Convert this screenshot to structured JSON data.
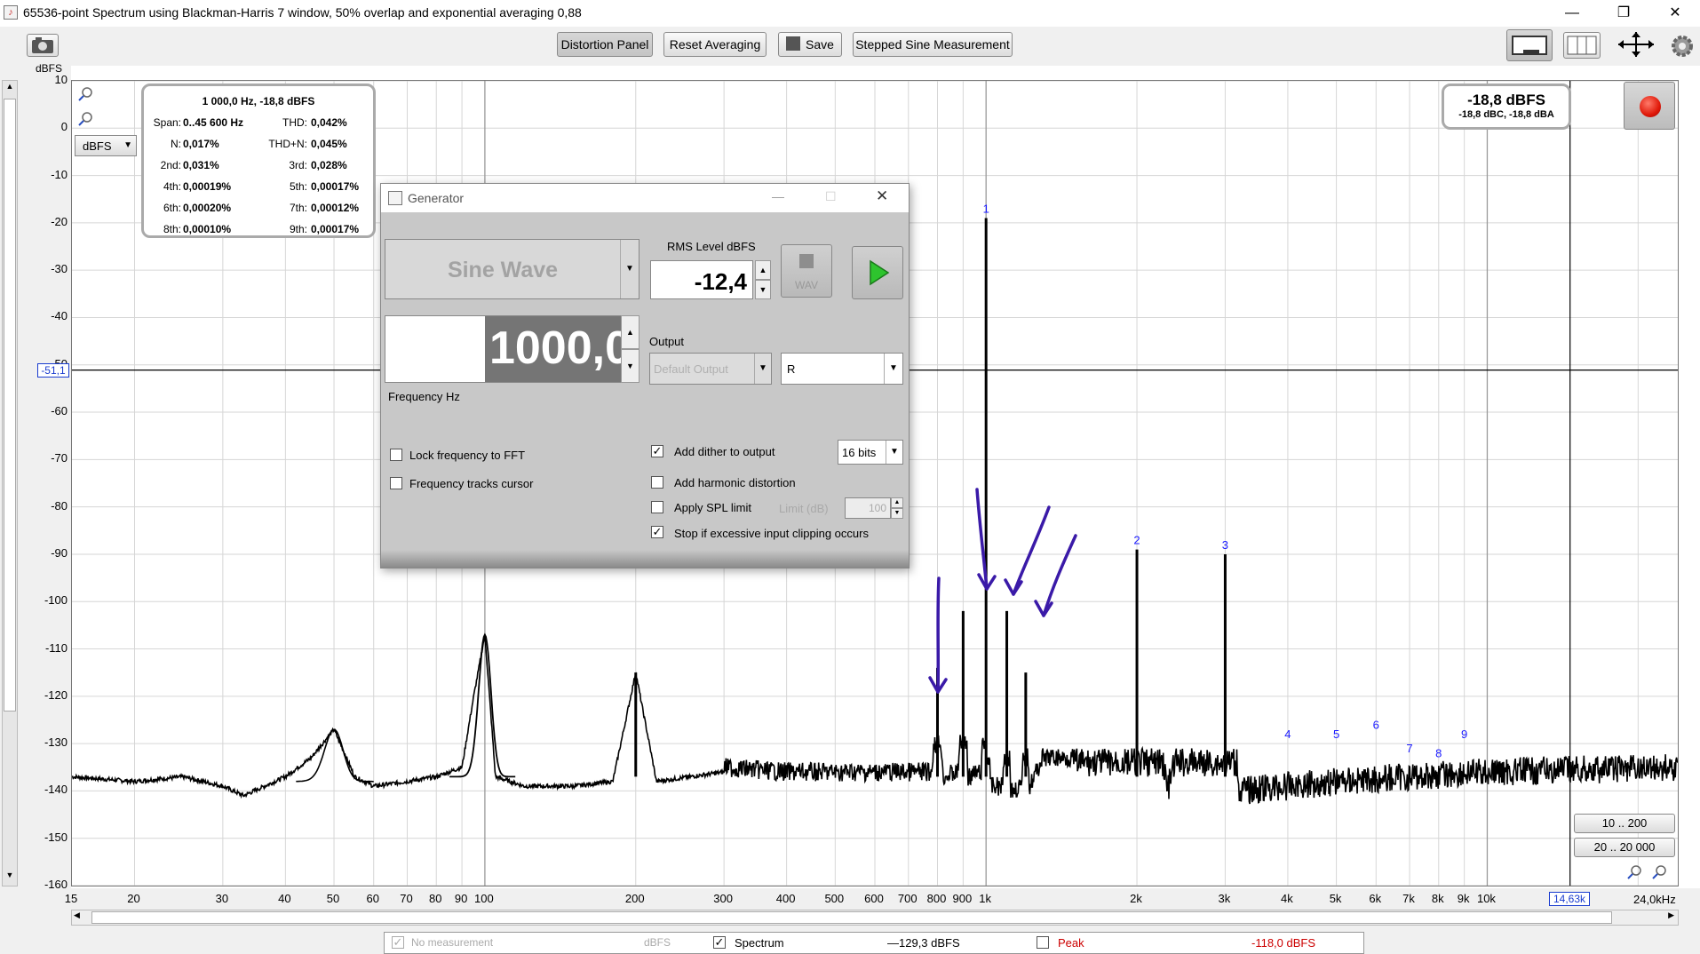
{
  "window": {
    "title": "65536-point Spectrum using Blackman-Harris 7 window, 50% overlap and exponential averaging 0,88",
    "minimize": "—",
    "restore": "❐",
    "close": "✕"
  },
  "toolbar": {
    "distortion_panel": "Distortion Panel",
    "reset_averaging": "Reset Averaging",
    "save": "Save",
    "stepped_sine": "Stepped Sine Measurement"
  },
  "axis": {
    "y_unit": "dBFS",
    "y_unit_selector": "dBFS",
    "x_unit": "24,0kHz",
    "cursor_level": "-51,1",
    "cursor_freq": "14,63k",
    "y_ticks": [
      "10",
      "0",
      "-10",
      "-20",
      "-30",
      "-40",
      "-50",
      "-60",
      "-70",
      "-80",
      "-90",
      "-100",
      "-110",
      "-120",
      "-130",
      "-140",
      "-150",
      "-160"
    ],
    "x_ticks": [
      "15",
      "20",
      "30",
      "40",
      "50",
      "60",
      "70",
      "80",
      "90",
      "100",
      "200",
      "300",
      "400",
      "500",
      "600",
      "700",
      "800",
      "900",
      "1k",
      "2k",
      "3k",
      "4k",
      "5k",
      "6k",
      "7k",
      "8k",
      "9k",
      "10k"
    ]
  },
  "stats": {
    "header": "1 000,0 Hz, -18,8 dBFS",
    "rows": [
      {
        "k1": "Span:",
        "v1": "0..45 600 Hz",
        "k2": "THD:",
        "v2": "0,042%"
      },
      {
        "k1": "N:",
        "v1": "0,017%",
        "k2": "THD+N:",
        "v2": "0,045%"
      },
      {
        "k1": "2nd:",
        "v1": "0,031%",
        "k2": "3rd:",
        "v2": "0,028%"
      },
      {
        "k1": "4th:",
        "v1": "0,00019%",
        "k2": "5th:",
        "v2": "0,00017%"
      },
      {
        "k1": "6th:",
        "v1": "0,00020%",
        "k2": "7th:",
        "v2": "0,00012%"
      },
      {
        "k1": "8th:",
        "v1": "0,00010%",
        "k2": "9th:",
        "v2": "0,00017%"
      }
    ]
  },
  "readout": {
    "main": "-18,8 dBFS",
    "sub": "-18,8 dBC, -18,8 dBA"
  },
  "harmonic_labels": [
    "1",
    "2",
    "3",
    "4",
    "5",
    "6",
    "7",
    "8",
    "9"
  ],
  "generator": {
    "title": "Generator",
    "waveform": "Sine Wave",
    "rms_label": "RMS Level dBFS",
    "rms_value": "-12,4",
    "wav_label": "WAV",
    "frequency": "1000,0",
    "frequency_label": "Frequency Hz",
    "output_label": "Output",
    "output_device": "Default Output",
    "output_channel": "R",
    "lock_freq": "Lock frequency to FFT",
    "freq_tracks": "Frequency tracks cursor",
    "add_dither": "Add dither to output",
    "dither_bits": "16 bits",
    "add_harmonic": "Add harmonic distortion",
    "apply_spl": "Apply SPL limit",
    "limit_label": "Limit (dB)",
    "limit_value": "100",
    "stop_clipping": "Stop if excessive input clipping occurs",
    "checked": "✓"
  },
  "range_buttons": {
    "r1": "10 .. 200",
    "r2": "20 .. 20 000"
  },
  "legend": {
    "no_measurement": "No measurement",
    "no_measurement_unit": "dBFS",
    "spectrum": "Spectrum",
    "spectrum_value": "—129,3 dBFS",
    "peak": "Peak",
    "peak_value": "-118,0 dBFS"
  },
  "colors": {
    "peak_red": "#cc0000",
    "annotation": "#3a1aa8",
    "harmonic_blue": "#1a1aff",
    "cursor_box": "#1a3ccf"
  },
  "chart_data": {
    "type": "line",
    "x_scale": "log",
    "xlim": [
      15,
      24000
    ],
    "ylim": [
      -160,
      10
    ],
    "ylabel": "dBFS",
    "grid": true,
    "series": [
      {
        "name": "Spectrum",
        "x": [
          15,
          20,
          25,
          30,
          33,
          40,
          45,
          50,
          55,
          60,
          70,
          80,
          90,
          95,
          100,
          105,
          120,
          150,
          180,
          200,
          220,
          300,
          400,
          500,
          600,
          700,
          780,
          800,
          820,
          880,
          900,
          920,
          980,
          1000,
          1020,
          1080,
          1100,
          1120,
          1180,
          1200,
          1220,
          2000,
          2300,
          3000,
          3200,
          5000,
          10000,
          24000
        ],
        "y": [
          -137,
          -138,
          -137,
          -139,
          -141,
          -137,
          -133,
          -127,
          -137,
          -139,
          -138,
          -137,
          -135,
          -120,
          -107,
          -137,
          -139,
          -139,
          -138,
          -115,
          -138,
          -136,
          -137,
          -137,
          -137,
          -137,
          -137,
          -114,
          -138,
          -137,
          -102,
          -138,
          -137,
          -19,
          -137,
          -137,
          -102,
          -138,
          -137,
          -115,
          -137,
          -89,
          -137,
          -90,
          -137,
          -135,
          -133,
          -132
        ]
      }
    ],
    "harmonics": [
      {
        "n": 1,
        "x": 1000,
        "y": -19
      },
      {
        "n": 2,
        "x": 2000,
        "y": -89
      },
      {
        "n": 3,
        "x": 3000,
        "y": -90
      },
      {
        "n": 4,
        "x": 4000,
        "y": -130
      },
      {
        "n": 5,
        "x": 5000,
        "y": -130
      },
      {
        "n": 6,
        "x": 6000,
        "y": -128
      },
      {
        "n": 7,
        "x": 7000,
        "y": -133
      },
      {
        "n": 8,
        "x": 8000,
        "y": -134
      },
      {
        "n": 9,
        "x": 9000,
        "y": -130
      }
    ]
  }
}
